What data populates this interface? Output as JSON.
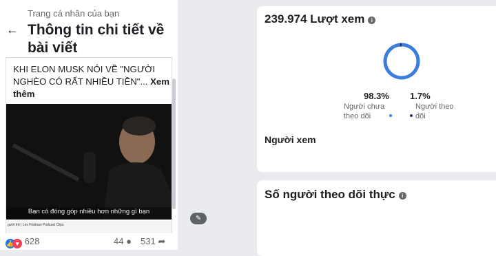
{
  "header": {
    "breadcrumb": "Trang cá nhân của bạn",
    "title": "Thông tin chi tiết về bài viết",
    "back_icon": "arrow-left-icon"
  },
  "post": {
    "caption": "KHI ELON MUSK NÓI VỀ \"NGƯỜI NGHÈO CÓ RẤT NHIỀU TIỀN\"... ",
    "see_more": "Xem thêm",
    "subtitle": "Bạn có đóng góp nhiều hơn những gì bạn",
    "video_bar_text": "gười trẻ | Lex Fridman Podcast Clips",
    "reactions": "628",
    "comments": "44",
    "shares": "531"
  },
  "views_card": {
    "total": "239.974 Lượt xem",
    "non_followers_pct": "98.3%",
    "non_followers_label": "Người chưa theo dõi",
    "followers_pct": "1.7%",
    "followers_label": "Người theo dõi",
    "viewers_heading": "Người xem"
  },
  "followers_card": {
    "title": "Số người theo dõi thực"
  },
  "colors": {
    "non_followers": "#3b7ddd",
    "followers": "#1a2f6e",
    "donut_track": "#dbe4f3"
  },
  "chart_data": {
    "type": "pie",
    "categories": [
      "Người chưa theo dõi",
      "Người theo dõi"
    ],
    "values": [
      98.3,
      1.7
    ]
  }
}
